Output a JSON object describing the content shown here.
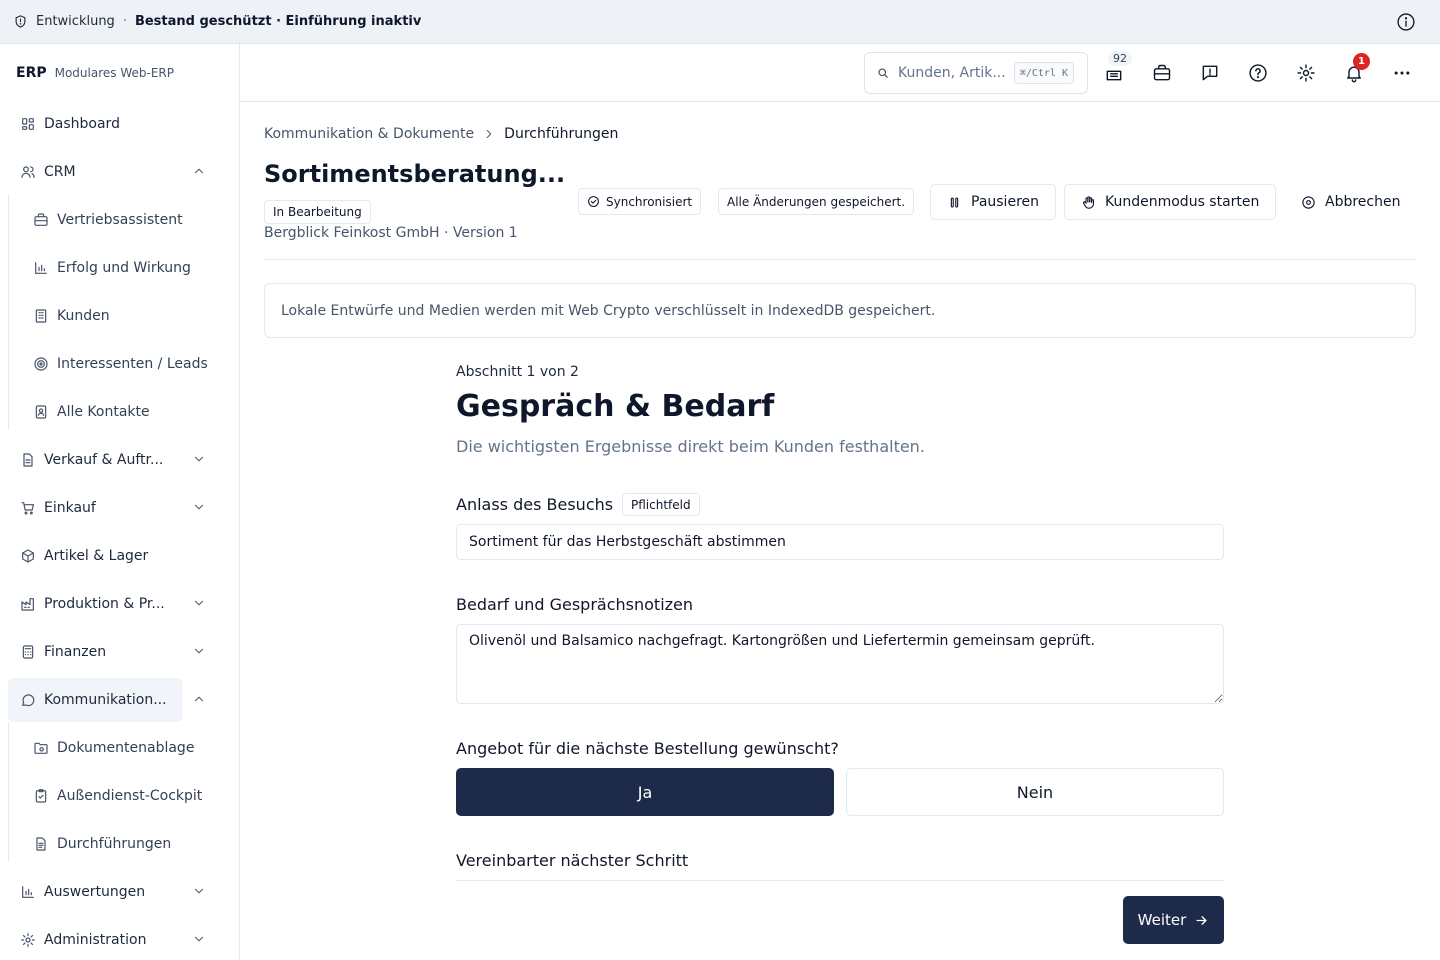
{
  "env_bar": {
    "environment": "Entwicklung",
    "separator": "·",
    "status": "Bestand geschützt · Einführung inaktiv"
  },
  "brand": {
    "logo": "ERP",
    "tagline": "Modulares Web-ERP"
  },
  "sidebar": {
    "items": [
      {
        "label": "Dashboard",
        "icon": "dashboard-icon"
      },
      {
        "label": "CRM",
        "icon": "users-icon",
        "expanded": true
      },
      {
        "label": "Vertriebsassistent",
        "icon": "briefcase-icon"
      },
      {
        "label": "Erfolg und Wirkung",
        "icon": "bar-chart-icon"
      },
      {
        "label": "Kunden",
        "icon": "building-icon"
      },
      {
        "label": "Interessenten / Leads",
        "icon": "target-icon"
      },
      {
        "label": "Alle Kontakte",
        "icon": "contact-card-icon"
      },
      {
        "label": "Verkauf & Auftr...",
        "icon": "document-icon"
      },
      {
        "label": "Einkauf",
        "icon": "cart-icon"
      },
      {
        "label": "Artikel & Lager",
        "icon": "package-icon"
      },
      {
        "label": "Produktion & Pr...",
        "icon": "factory-icon"
      },
      {
        "label": "Finanzen",
        "icon": "calculator-icon"
      },
      {
        "label": "Kommunikation...",
        "icon": "chat-icon",
        "expanded": true,
        "active": true
      },
      {
        "label": "Dokumentenablage",
        "icon": "folder-icon"
      },
      {
        "label": "Außendienst-Cockpit",
        "icon": "clipboard-icon"
      },
      {
        "label": "Durchführungen",
        "icon": "file-text-icon"
      },
      {
        "label": "Auswertungen",
        "icon": "bar-chart-icon"
      },
      {
        "label": "Administration",
        "icon": "gear-icon"
      }
    ]
  },
  "header": {
    "search_placeholder": "Kunden, Artik...",
    "search_shortcut": "⌘/Ctrl K",
    "inbox_count": "92",
    "notification_count": "1"
  },
  "breadcrumb": {
    "parent": "Kommunikation & Dokumente",
    "current": "Durchführungen"
  },
  "page": {
    "title": "Sortimentsberatung...",
    "status": "In Bearbeitung",
    "subtitle": "Bergblick Feinkost GmbH · Version 1",
    "sync_status": "Synchronisiert",
    "save_status": "Alle Änderungen gespeichert.",
    "pause_label": "Pausieren",
    "customer_mode_label": "Kundenmodus starten",
    "cancel_label": "Abbrechen",
    "notice": "Lokale Entwürfe und Medien werden mit Web Crypto verschlüsselt in IndexedDB gespeichert."
  },
  "form": {
    "section_count": "Abschnitt 1 von 2",
    "section_title": "Gespräch & Bedarf",
    "section_description": "Die wichtigsten Ergebnisse direkt beim Kunden festhalten.",
    "occasion_label": "Anlass des Besuchs",
    "required_badge": "Pflichtfeld",
    "occasion_value": "Sortiment für das Herbstgeschäft abstimmen",
    "notes_label": "Bedarf und Gesprächsnotizen",
    "notes_value": "Olivenöl und Balsamico nachgefragt. Kartongrößen und Liefertermin gemeinsam geprüft.",
    "offer_question": "Angebot für die nächste Bestellung gewünscht?",
    "offer_yes": "Ja",
    "offer_no": "Nein",
    "offer_selected": "Ja",
    "next_step_label": "Vereinbarter nächster Schritt",
    "next_button": "Weiter"
  },
  "colors": {
    "primary": "#1e2a4a",
    "alert": "#dc2626",
    "env_bar_bg": "#eef2f7",
    "muted_text": "#475569"
  }
}
